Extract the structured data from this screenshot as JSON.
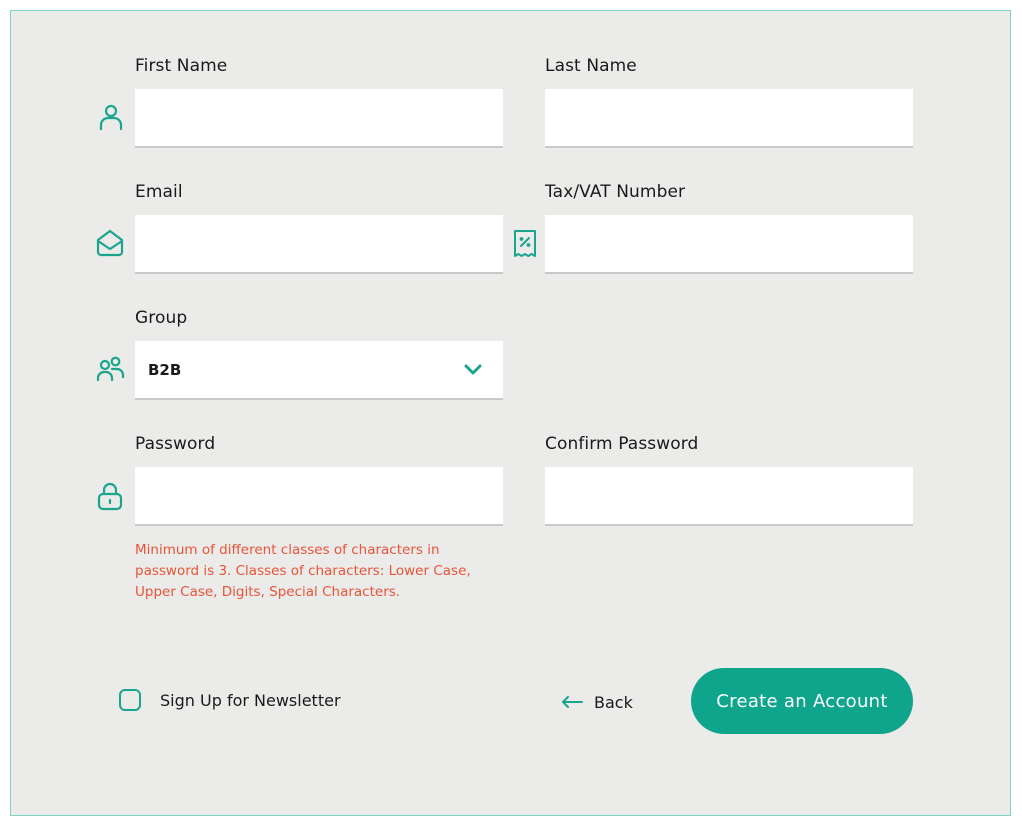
{
  "form": {
    "first_name": {
      "label": "First Name",
      "value": "",
      "icon": "user-icon"
    },
    "last_name": {
      "label": "Last Name",
      "value": ""
    },
    "email": {
      "label": "Email",
      "value": "",
      "icon": "envelope-open-icon"
    },
    "tax_vat": {
      "label": "Tax/VAT Number",
      "value": "",
      "icon": "receipt-percent-icon"
    },
    "group": {
      "label": "Group",
      "value": "B2B",
      "icon": "users-icon"
    },
    "password": {
      "label": "Password",
      "value": "",
      "icon": "lock-icon"
    },
    "confirm_password": {
      "label": "Confirm Password",
      "value": ""
    },
    "password_hint": "Minimum of different classes of characters in password is 3. Classes of characters: Lower Case, Upper Case, Digits, Special Characters."
  },
  "footer": {
    "newsletter_label": "Sign Up for Newsletter",
    "newsletter_checked": false,
    "back_label": "Back",
    "submit_label": "Create an Account"
  },
  "colors": {
    "accent": "#0ea58c",
    "error": "#ea5437",
    "background": "#ebebea"
  }
}
